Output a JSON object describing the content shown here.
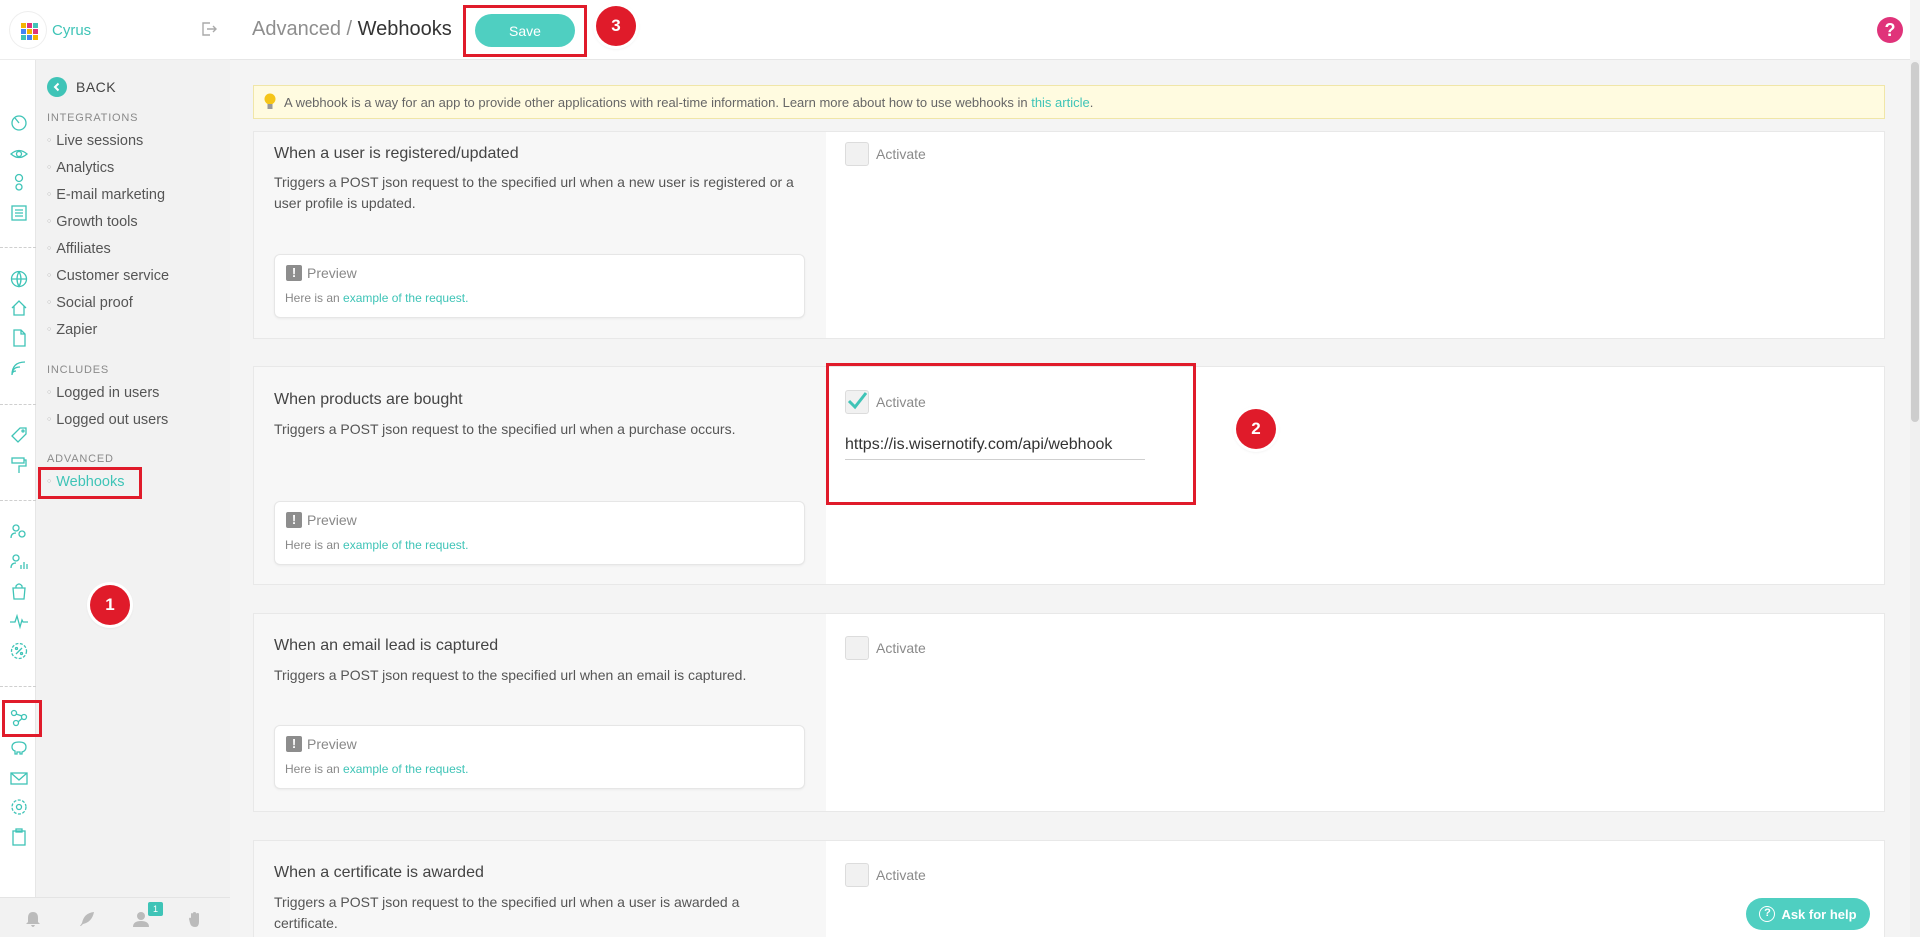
{
  "brand": {
    "name": "Cyrus"
  },
  "header": {
    "breadcrumb_parent": "Advanced",
    "breadcrumb_sep": " / ",
    "breadcrumb_current": "Webhooks",
    "save_label": "Save",
    "help_glyph": "?"
  },
  "nav": {
    "back_label": "BACK",
    "sections": {
      "integrations": "INTEGRATIONS",
      "includes": "INCLUDES",
      "advanced": "ADVANCED"
    },
    "integrations_items": [
      "Live sessions",
      "Analytics",
      "E-mail marketing",
      "Growth tools",
      "Affiliates",
      "Customer service",
      "Social proof",
      "Zapier"
    ],
    "includes_items": [
      "Logged in users",
      "Logged out users"
    ],
    "advanced_items": [
      "Webhooks"
    ]
  },
  "notice": {
    "text": "A webhook is a way for an app to provide other applications with real-time information. Learn more about how to use webhooks in ",
    "link": "this article",
    "end": "."
  },
  "webhooks": [
    {
      "title": "When a user is registered/updated",
      "description": "Triggers a POST json request to the specified url when a new user is registered or a user profile is updated.",
      "activate_label": "Activate",
      "checked": false
    },
    {
      "title": "When products are bought",
      "description": "Triggers a POST json request to the specified url when a purchase occurs.",
      "activate_label": "Activate",
      "checked": true,
      "url": "https://is.wisernotify.com/api/webhook"
    },
    {
      "title": "When an email lead is captured",
      "description": "Triggers a POST json request to the specified url when an email is captured.",
      "activate_label": "Activate",
      "checked": false
    },
    {
      "title": "When a certificate is awarded",
      "description": "Triggers a POST json request to the specified url when a user is awarded a certificate.",
      "activate_label": "Activate",
      "checked": false
    }
  ],
  "preview": {
    "title": "Preview",
    "text": "Here is an ",
    "link": "example of the request."
  },
  "bottom": {
    "notification_count": "1"
  },
  "annotations": {
    "m1": "1",
    "m2": "2",
    "m3": "3"
  },
  "ask_help": "Ask for help",
  "colors": {
    "accent": "#3fc4b7",
    "button": "#4fcfc1",
    "annotation": "#e01b2a",
    "help": "#e0337a"
  }
}
